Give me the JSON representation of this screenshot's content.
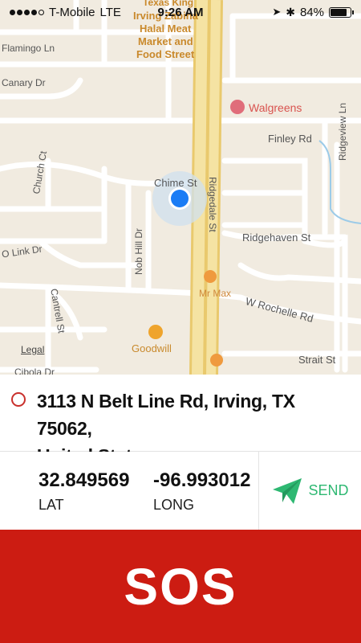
{
  "status_bar": {
    "carrier": "T-Mobile",
    "network": "LTE",
    "time": "9:26 AM",
    "battery_percent": "84%",
    "battery_level": 0.84,
    "signal_bars_filled": 4,
    "icons": [
      "location-arrow-icon",
      "bluetooth-icon",
      "battery-icon"
    ]
  },
  "map": {
    "streets": {
      "flamingo": "Flamingo Ln",
      "canary": "Canary Dr",
      "finley": "Finley Rd",
      "ridgedale": "Ridgedale St",
      "ridgeview": "Ridgeview Ln",
      "chime": "Chime St",
      "church": "Church Ct",
      "ridgehaven": "Ridgehaven St",
      "olink": "O Link Dr",
      "nobhill": "Nob Hill Dr",
      "wrochelle": "W Rochelle Rd",
      "cantrell": "Cantrell St",
      "strait": "Strait St",
      "cibola": "Cibola Dr"
    },
    "pois": {
      "texas_king": "Texas King",
      "irving_zabiha": "Irving Zabiha",
      "halal": "Halal Meat",
      "market": "Market and",
      "food": "Food Street",
      "walgreens": "Walgreens",
      "mrmax": "Mr Max",
      "goodwill": "Goodwill"
    },
    "legal": "Legal",
    "colors": {
      "background": "#f1ebe0",
      "road": "#ffffff",
      "highway": "#f2d98a",
      "user_dot": "#1a7cf5"
    }
  },
  "address": {
    "line1": "3113 N Belt Line Rd, Irving, TX  75062,",
    "line2": "United States"
  },
  "coordinates": {
    "lat_value": "32.849569",
    "lat_label": "LAT",
    "long_value": "-96.993012",
    "long_label": "LONG"
  },
  "send": {
    "label": "SEND",
    "color": "#2eb872"
  },
  "sos": {
    "label": "SOS",
    "color": "#cc1c12"
  }
}
